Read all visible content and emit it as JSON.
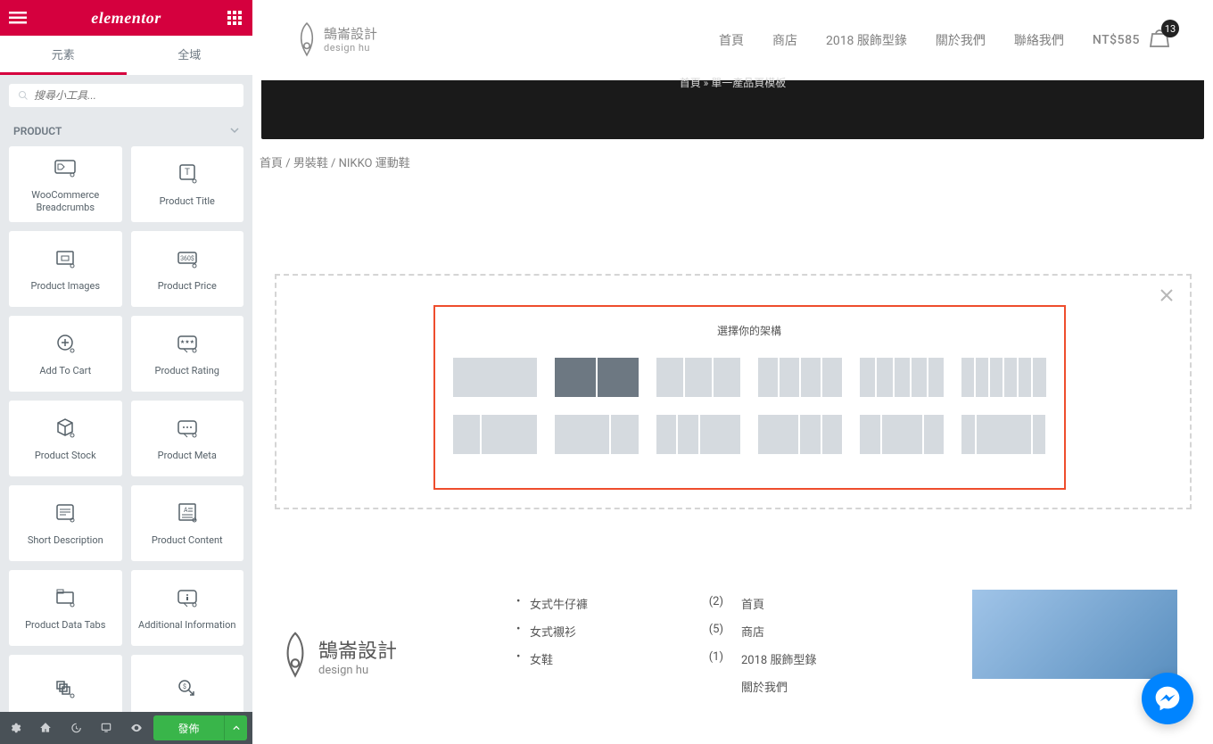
{
  "sidebar": {
    "logo": "elementor",
    "tabs": {
      "elements": "元素",
      "global": "全域"
    },
    "search_placeholder": "搜尋小工具...",
    "category": "PRODUCT",
    "widgets": [
      {
        "label": "WooCommerce Breadcrumbs",
        "icon": "breadcrumb"
      },
      {
        "label": "Product Title",
        "icon": "title"
      },
      {
        "label": "Product Images",
        "icon": "images"
      },
      {
        "label": "Product Price",
        "icon": "price"
      },
      {
        "label": "Add To Cart",
        "icon": "addcart"
      },
      {
        "label": "Product Rating",
        "icon": "rating"
      },
      {
        "label": "Product Stock",
        "icon": "stock"
      },
      {
        "label": "Product Meta",
        "icon": "meta"
      },
      {
        "label": "Short Description",
        "icon": "shortdesc"
      },
      {
        "label": "Product Content",
        "icon": "content"
      },
      {
        "label": "Product Data Tabs",
        "icon": "tabs"
      },
      {
        "label": "Additional Information",
        "icon": "addinfo"
      },
      {
        "label": "",
        "icon": "related"
      },
      {
        "label": "",
        "icon": "upsell"
      }
    ],
    "publish": "發佈"
  },
  "preview": {
    "logo_cn": "鵠崙設計",
    "logo_en": "design hu",
    "nav": [
      "首頁",
      "商店",
      "2018 服飾型錄",
      "關於我們",
      "聯絡我們"
    ],
    "cart_price": "NT$585",
    "cart_count": "13",
    "hero_crumb": "首頁 » 單一產品頁模板",
    "breadcrumb": "首頁 / 男裝鞋 / NIKKO 運動鞋",
    "structure_title": "選擇你的架構",
    "structures": [
      [
        100
      ],
      [
        50,
        50
      ],
      [
        33,
        33,
        33
      ],
      [
        25,
        25,
        25,
        25
      ],
      [
        20,
        20,
        20,
        20,
        20
      ],
      [
        16,
        16,
        16,
        16,
        16,
        16
      ],
      [
        33,
        66
      ],
      [
        66,
        33
      ],
      [
        25,
        25,
        50
      ],
      [
        50,
        25,
        25
      ],
      [
        25,
        50,
        25
      ],
      [
        16,
        66,
        16
      ]
    ],
    "footer": {
      "categories": [
        {
          "name": "女式牛仔褲",
          "count": "(2)"
        },
        {
          "name": "女式襯衫",
          "count": "(5)"
        },
        {
          "name": "女鞋",
          "count": "(1)"
        }
      ],
      "links": [
        "首頁",
        "商店",
        "2018 服飾型錄",
        "關於我們"
      ]
    }
  }
}
